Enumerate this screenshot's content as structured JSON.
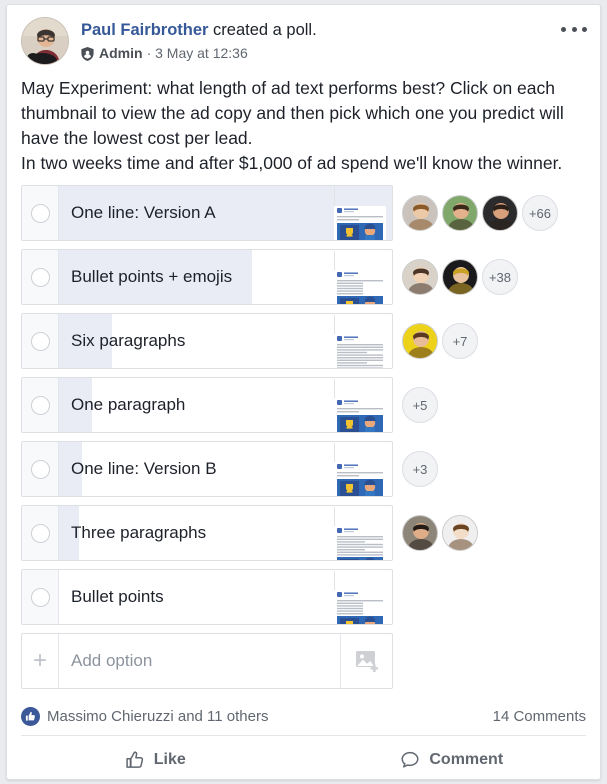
{
  "post": {
    "author": "Paul Fairbrother",
    "action": " created a poll.",
    "admin_label": "Admin",
    "meta": "· 3 May at 12:36",
    "avatar_name": "paul-fairbrother-avatar",
    "menu_icon": "more-options-icon",
    "shield_icon": "admin-shield-icon",
    "body": [
      "May Experiment: what length of ad text performs best? Click on each thumbnail to view the ad copy and then pick which one you predict will have the lowest cost per lead.",
      "In two weeks time and after $1,000 of ad spend we'll know the winner."
    ]
  },
  "poll": {
    "options": [
      {
        "label": "One line: Version A",
        "fill_pct": 100,
        "avatars": 3,
        "more": "+66",
        "thumb": "ad-preview-short"
      },
      {
        "label": "Bullet points + emojis",
        "fill_pct": 58,
        "avatars": 2,
        "more": "+38",
        "thumb": "ad-preview-bullets"
      },
      {
        "label": "Six paragraphs",
        "fill_pct": 16,
        "avatars": 1,
        "more": "+7",
        "thumb": "ad-preview-long"
      },
      {
        "label": "One paragraph",
        "fill_pct": 10,
        "avatars": 0,
        "more": "+5",
        "thumb": "ad-preview-short"
      },
      {
        "label": "One line: Version B",
        "fill_pct": 7,
        "avatars": 0,
        "more": "+3",
        "thumb": "ad-preview-short"
      },
      {
        "label": "Three paragraphs",
        "fill_pct": 6,
        "avatars": 2,
        "more": "",
        "thumb": "ad-preview-medium"
      },
      {
        "label": "Bullet points",
        "fill_pct": 0,
        "avatars": 0,
        "more": "",
        "thumb": "ad-preview-bullets"
      }
    ],
    "add_option": {
      "placeholder": "Add option",
      "plus_icon": "plus-icon",
      "photo_icon": "add-photo-icon"
    }
  },
  "footer": {
    "reactions_text": "Massimo Chieruzzi and 11 others",
    "comments_text": "14 Comments",
    "like_label": "Like",
    "comment_label": "Comment",
    "like_icon": "thumbs-up-icon",
    "comment_icon": "speech-bubble-icon",
    "reaction_badge_icon": "like-reaction-icon"
  },
  "colors": {
    "accent": "#365899",
    "fill": "#e9ecf5",
    "like_blue": "#3b5998",
    "muted_text": "#616770"
  }
}
